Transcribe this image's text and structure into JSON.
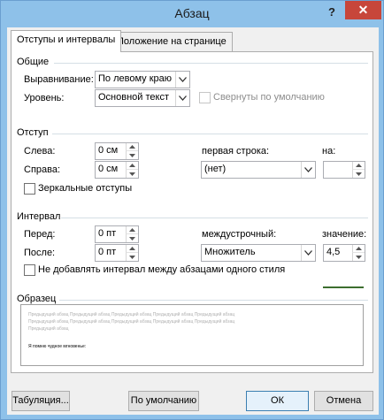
{
  "window": {
    "title": "Абзац",
    "help": "?",
    "close": "✕"
  },
  "tabs": [
    {
      "label": "Отступы и интервалы",
      "active": true
    },
    {
      "label": "Положение на странице",
      "active": false
    }
  ],
  "general": {
    "header": "Общие",
    "alignment_label": "Выравнивание:",
    "alignment_value": "По левому краю",
    "level_label": "Уровень:",
    "level_value": "Основной текст",
    "collapsed_label": "Свернуты по умолчанию"
  },
  "indent": {
    "header": "Отступ",
    "left_label": "Слева:",
    "left_value": "0 см",
    "right_label": "Справа:",
    "right_value": "0 см",
    "first_line_label": "первая строка:",
    "first_line_value": "(нет)",
    "on_label": "на:",
    "on_value": "",
    "mirror_label": "Зеркальные отступы"
  },
  "spacing": {
    "header": "Интервал",
    "before_label": "Перед:",
    "before_value": "0 пт",
    "after_label": "После:",
    "after_value": "0 пт",
    "line_label": "междустрочный:",
    "line_value": "Множитель",
    "value_label": "значение:",
    "value_value": "4,5",
    "no_space_label": "Не добавлять интервал между абзацами одного стиля"
  },
  "preview": {
    "header": "Образец",
    "prev_line": "Предыдущий абзац Предыдущий абзац Предыдущий абзац Предыдущий абзац Предыдущий абзац",
    "prev_line_short": "Предыдущий абзац",
    "sample_text": "Я помню чудное мгновенье:"
  },
  "buttons": {
    "tabs": "Табуляция...",
    "default": "По умолчанию",
    "ok": "ОК",
    "cancel": "Отмена"
  }
}
